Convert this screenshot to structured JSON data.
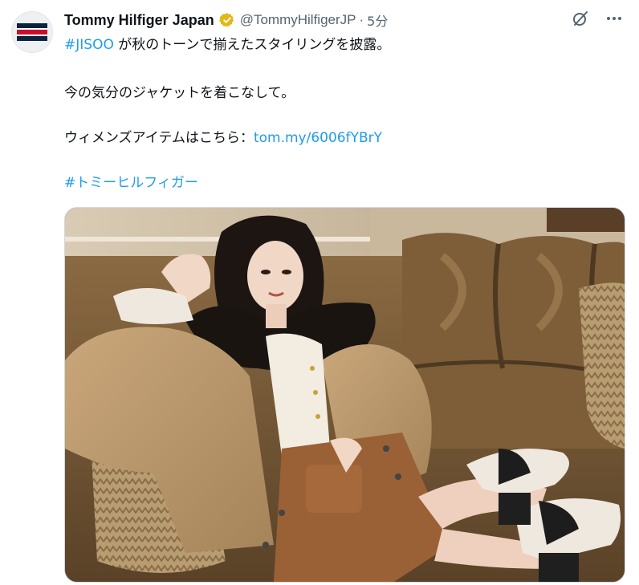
{
  "tweet": {
    "author_name": "Tommy Hilfiger Japan",
    "handle": "@TommyHilfigerJP",
    "separator": "·",
    "time": "5分",
    "lines": {
      "l1_hashtag": "#JISOO",
      "l1_text": " が秋のトーンで揃えたスタイリングを披露。",
      "l2_text": "今の気分のジャケットを着こなして。",
      "l3_text": "ウィメンズアイテムはこちら：",
      "l3_link": "tom.my/6006fYBrY",
      "l4_hashtag": "#トミーヒルフィガー"
    }
  },
  "icons": {
    "avatar": "tommy-hilfiger-flag-logo",
    "verified": "verified-gold-badge",
    "grok": "grok-icon",
    "more": "more-dots-icon"
  },
  "colors": {
    "link": "#1d9bf0",
    "secondary_text": "#536471",
    "badge_gold": "#e2b719",
    "flag_navy": "#0c2340",
    "flag_red": "#c8102e"
  }
}
